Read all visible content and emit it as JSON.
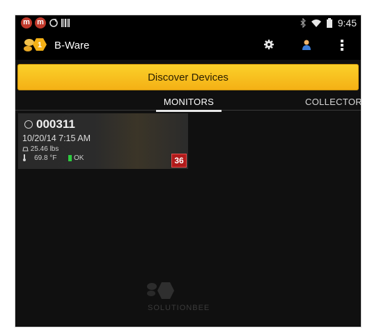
{
  "status_bar": {
    "notifications": [
      "m",
      "m"
    ],
    "time": "9:45"
  },
  "action_bar": {
    "app_title": "B-Ware",
    "icons": [
      "settings-icon",
      "account-icon",
      "overflow-menu-icon"
    ]
  },
  "discover_button": {
    "label": "Discover Devices"
  },
  "tabs": [
    {
      "label": "MONITORS",
      "selected": true
    },
    {
      "label": "COLLECTORS",
      "selected": false
    }
  ],
  "monitor_card": {
    "id": "000311",
    "date": "10/20/14 7:15 AM",
    "weight": "25.46 lbs",
    "temperature": "69.8 °F",
    "status": "OK",
    "badge": "36"
  },
  "watermark": {
    "text": "SOLUTIONBEE"
  },
  "colors": {
    "accent_yellow": "#f4b015",
    "badge_red": "#b01a1a",
    "ok_green": "#2ecc40"
  }
}
